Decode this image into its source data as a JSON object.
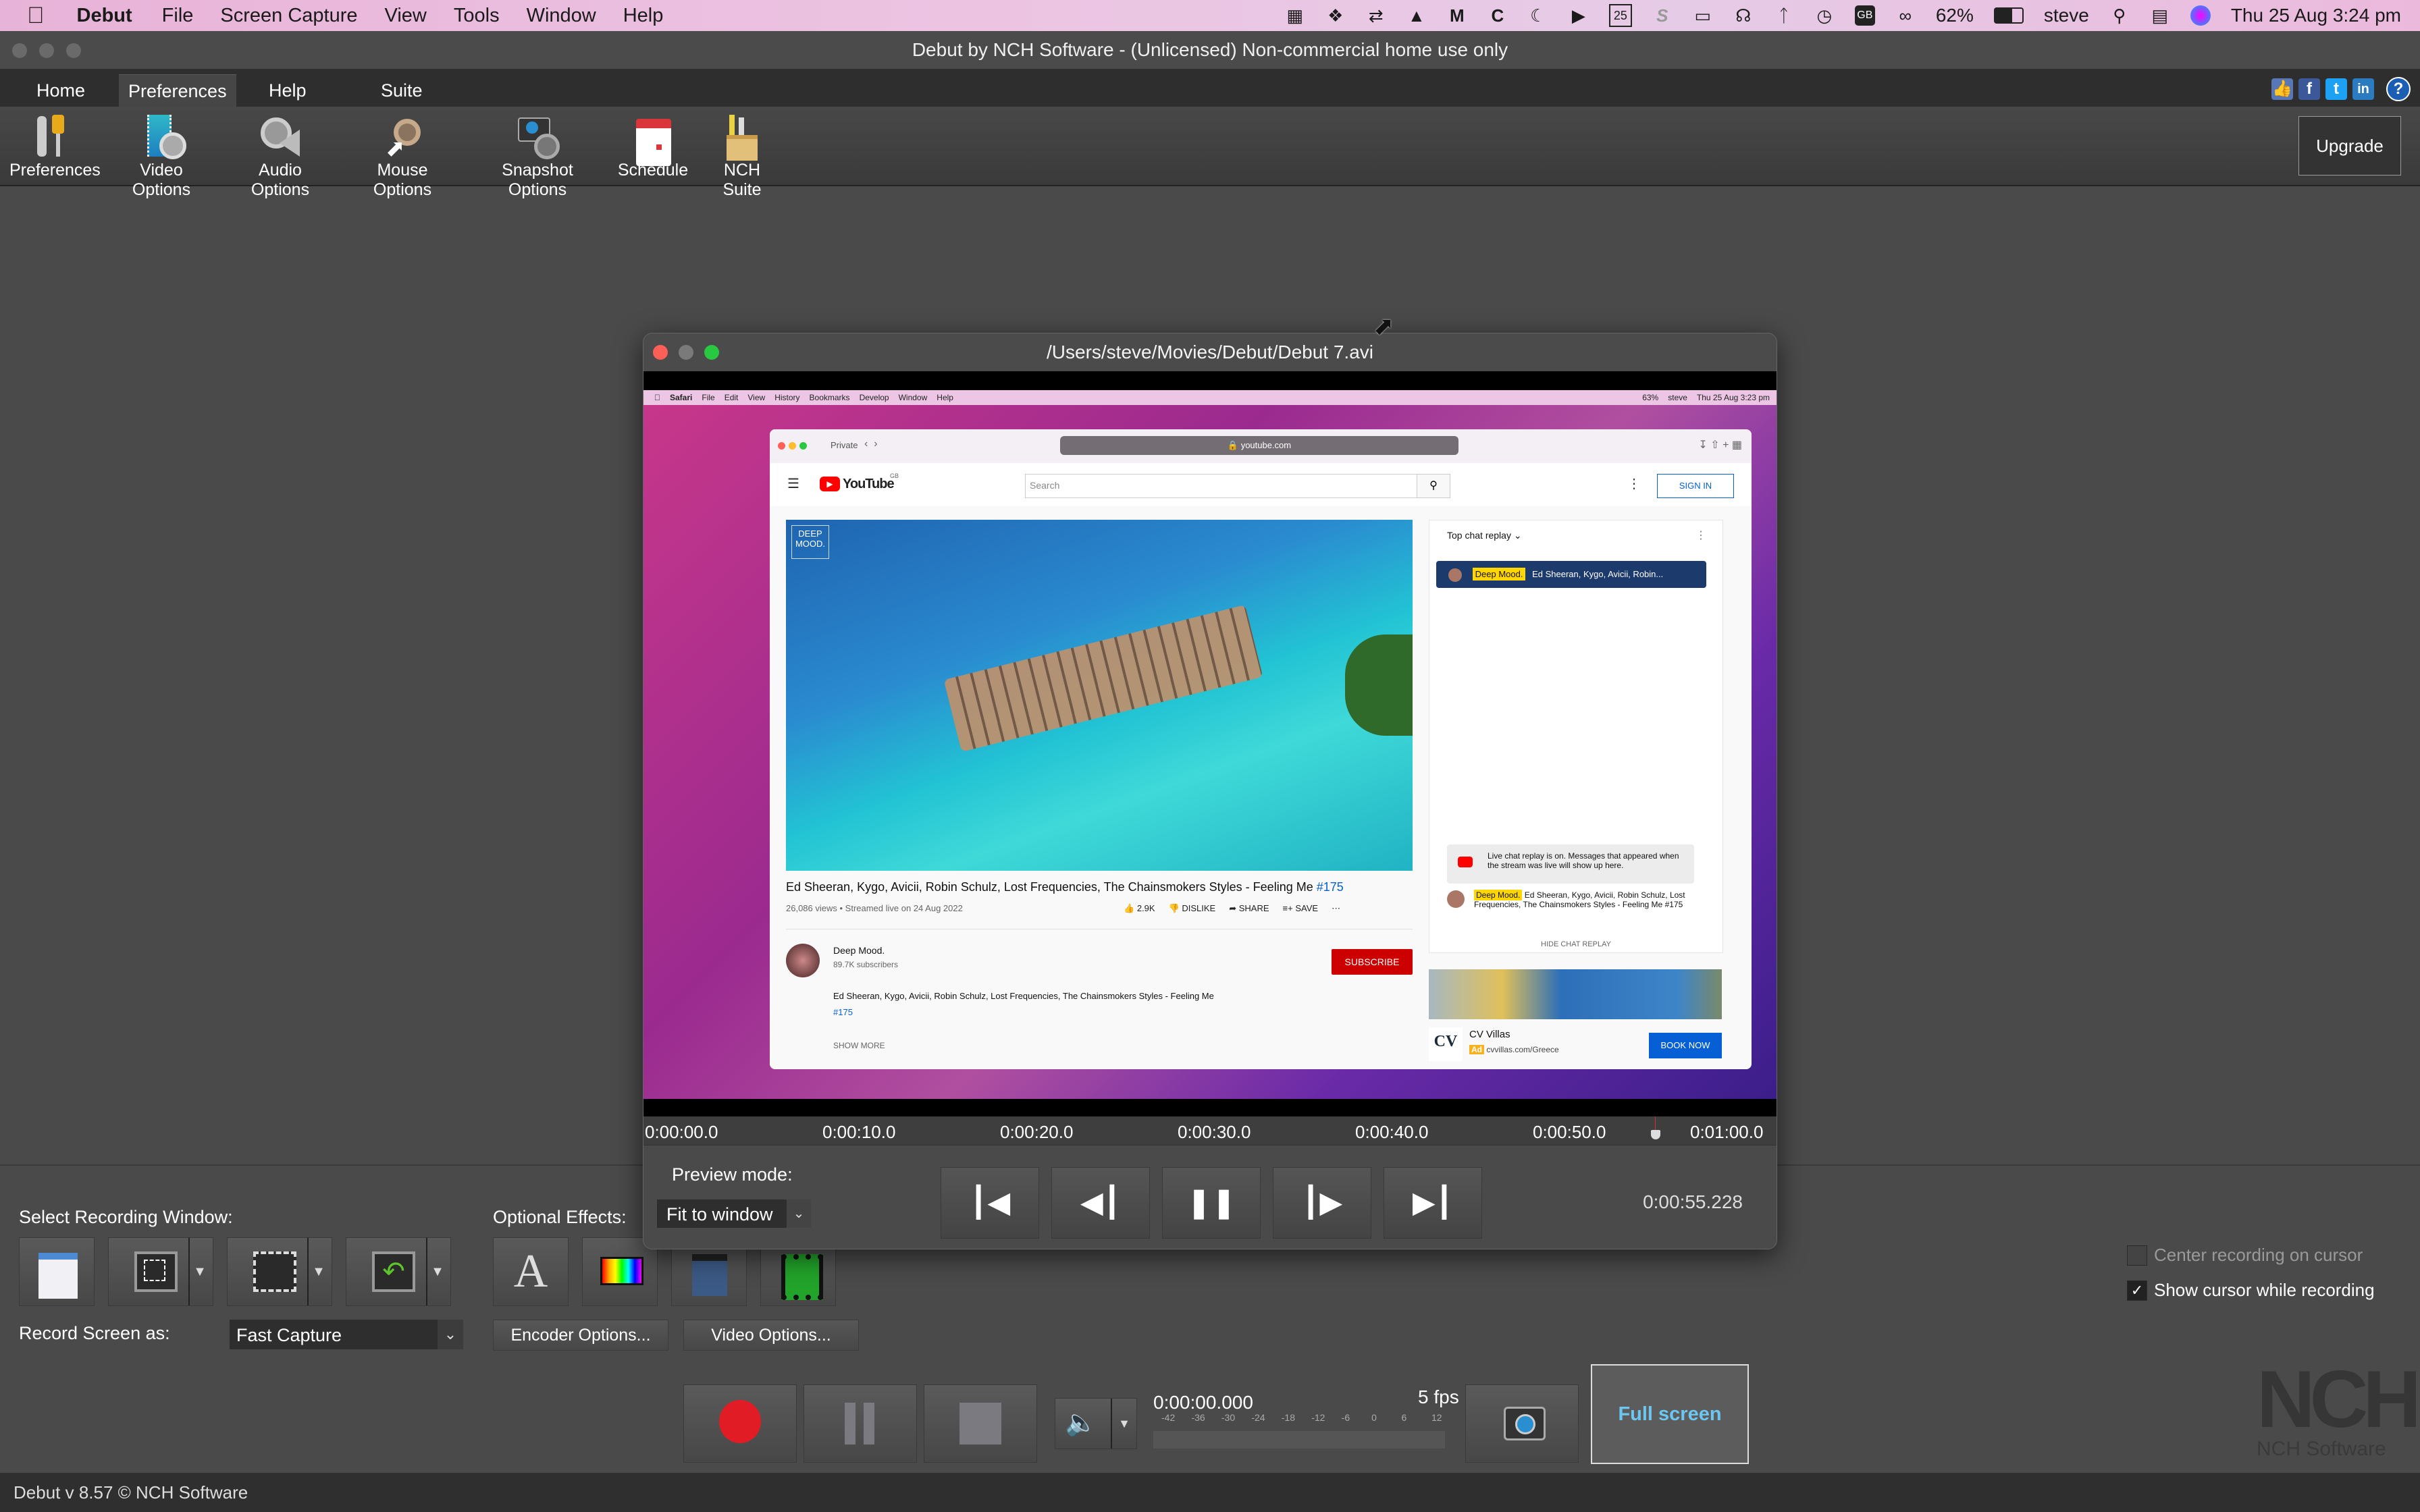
{
  "mac_menubar": {
    "app_name": "Debut",
    "menus": [
      "File",
      "Screen Capture",
      "View",
      "Tools",
      "Window",
      "Help"
    ],
    "status_icons": [
      "film-strip-icon",
      "dropbox-icon",
      "transfer-icon",
      "vpn-icon",
      "malwarebytes-icon",
      "c-icon",
      "moon-icon",
      "play-icon",
      "calendar-icon",
      "s-icon",
      "display-icon",
      "headphones-icon",
      "bluetooth-icon",
      "time-machine-icon",
      "keyboard-gb-icon",
      "link-icon"
    ],
    "battery": "62%",
    "user": "steve",
    "datetime": "Thu 25 Aug  3:24 pm"
  },
  "window": {
    "title": "Debut by NCH Software - (Unlicensed) Non-commercial home use only"
  },
  "tabs": [
    {
      "label": "Home",
      "active": false
    },
    {
      "label": "Preferences",
      "active": true
    },
    {
      "label": "Help",
      "active": false
    },
    {
      "label": "Suite",
      "active": false
    }
  ],
  "social": [
    "like-icon",
    "facebook-icon",
    "twitter-icon",
    "linkedin-icon",
    "help-icon"
  ],
  "toolbar": {
    "items": [
      {
        "label": "Preferences",
        "icon": "tools-icon"
      },
      {
        "label": "Video Options",
        "icon": "video-gear-icon"
      },
      {
        "label": "Audio Options",
        "icon": "speaker-gear-icon"
      },
      {
        "label": "Mouse Options",
        "icon": "gear-icon"
      },
      {
        "label": "Snapshot Options",
        "icon": "camera-gear-icon"
      },
      {
        "label": "Schedule",
        "icon": "calendar-icon"
      },
      {
        "label": "NCH Suite",
        "icon": "suite-box-icon"
      }
    ],
    "upgrade_label": "Upgrade"
  },
  "preview": {
    "title": "/Users/steve/Movies/Debut/Debut 7.avi",
    "recorded": {
      "safari_menu": [
        "Safari",
        "File",
        "Edit",
        "View",
        "History",
        "Bookmarks",
        "Develop",
        "Window",
        "Help"
      ],
      "safari_clock": "Thu 25 Aug  3:23 pm",
      "safari_battery": "63%",
      "safari_user": "steve",
      "private_label": "Private",
      "url": "youtube.com",
      "yt_logo": "YouTube",
      "yt_region": "GB",
      "search_placeholder": "Search",
      "sign_in": "SIGN IN",
      "video_watermark": "DEEP MOOD.",
      "video_title": "Ed Sheeran, Kygo, Avicii, Robin Schulz, Lost Frequencies, The Chainsmokers Styles - Feeling Me",
      "video_hashtag": "#175",
      "views": "26,086 views • Streamed live on 24 Aug 2022",
      "likes": "2.9K",
      "dislike": "DISLIKE",
      "share": "SHARE",
      "save": "SAVE",
      "channel": "Deep Mood.",
      "subscribers": "89.7K subscribers",
      "subscribe": "SUBSCRIBE",
      "description": "Ed Sheeran, Kygo, Avicii, Robin Schulz, Lost Frequencies, The Chainsmokers Styles - Feeling Me",
      "description_tag": "#175",
      "show_more": "SHOW MORE",
      "chat_header": "Top chat replay",
      "pinned_author": "Deep Mood.",
      "pinned_text": "Ed Sheeran, Kygo, Avicii, Robin...",
      "chat_notice": "Live chat replay is on. Messages that appeared when the stream was live will show up here.",
      "chat_msg_author": "Deep Mood.",
      "chat_msg_text": "Ed Sheeran, Kygo, Avicii, Robin Schulz, Lost Frequencies, The Chainsmokers Styles - Feeling Me #175",
      "hide_chat": "HIDE CHAT REPLAY",
      "ad_name": "CV Villas",
      "ad_badge": "Ad",
      "ad_url": "cvvillas.com/Greece",
      "ad_cta": "BOOK NOW",
      "ad_logo": "CV"
    },
    "timeline_ticks": [
      "0:00:00.0",
      "0:00:10.0",
      "0:00:20.0",
      "0:00:30.0",
      "0:00:40.0",
      "0:00:50.0",
      "0:01:00.0"
    ],
    "playhead_seconds": 55.228,
    "timeline_max_seconds": 60,
    "preview_mode_label": "Preview mode:",
    "preview_mode_value": "Fit to window",
    "current_time": "0:00:55.228"
  },
  "recording": {
    "select_window_label": "Select Recording Window:",
    "optional_effects_label": "Optional Effects:",
    "record_as_label": "Record Screen as:",
    "record_as_value": "Fast Capture",
    "encoder_options": "Encoder Options...",
    "video_options": "Video Options...",
    "elapsed": "0:00:00.000",
    "fps": "5 fps",
    "meter_ticks": [
      "-42",
      "-36",
      "-30",
      "-24",
      "-18",
      "-12",
      "-6",
      "0",
      "6",
      "12"
    ],
    "full_screen": "Full screen",
    "center_on_cursor": {
      "label": "Center recording on cursor",
      "checked": false
    },
    "show_cursor": {
      "label": "Show cursor while recording",
      "checked": true
    }
  },
  "branding": {
    "logo": "NCH",
    "logo_sub": "NCH Software"
  },
  "status": "Debut v 8.57 © NCH Software",
  "colors": {
    "record_red": "#e21c24",
    "full_screen_text": "#6cc6f0",
    "bg": "#4a4a4a"
  }
}
